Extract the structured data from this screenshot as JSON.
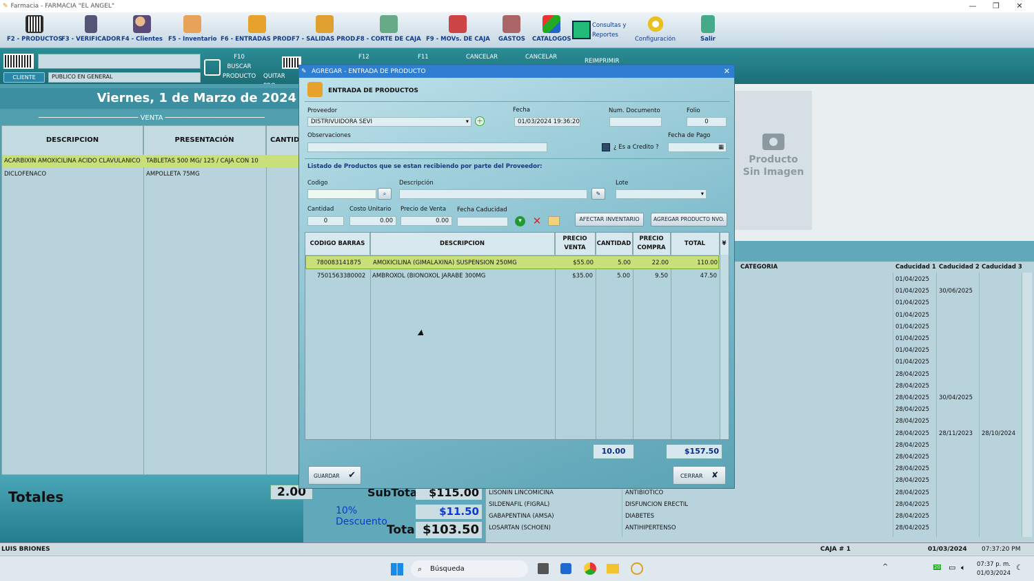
{
  "window": {
    "title": "Farmacia  -  FARMACIA \"EL ANGEL\""
  },
  "toolbar": [
    {
      "key": "f2",
      "label": "F2 - PRODUCTOS"
    },
    {
      "key": "f3",
      "label": "F3 - VERIFICADOR"
    },
    {
      "key": "f4",
      "label": "F4 - Clientes"
    },
    {
      "key": "f5",
      "label": "F5 - Inventario"
    },
    {
      "key": "f6",
      "label": "F6 - ENTRADAS PROD."
    },
    {
      "key": "f7",
      "label": "F7 - SALIDAS PROD."
    },
    {
      "key": "f8",
      "label": "F8 - CORTE DE CAJA"
    },
    {
      "key": "f9",
      "label": "F9 - MOVs. DE CAJA"
    },
    {
      "key": "gastos",
      "label": "GASTOS"
    },
    {
      "key": "catalogos",
      "label": "CATALOGOS"
    },
    {
      "key": "consultas",
      "label": "Consultas y Reportes"
    },
    {
      "key": "config",
      "label": "Configuración"
    },
    {
      "key": "salir",
      "label": "Salir"
    }
  ],
  "strip": {
    "cliente_btn": "CLIENTE",
    "cliente_value": "PUBLICO EN GENERAL",
    "f10_key": "F10",
    "f10_label1": "BUSCAR",
    "f10_label2": "PRODUCTO",
    "quitar": "QUITAR PRO",
    "f12": "F12",
    "f11": "F11",
    "cancelar1": "CANCELAR",
    "cancelar2": "CANCELAR",
    "reimprimir": "REIMPRIMIR"
  },
  "sale": {
    "date": "Viernes, 1 de Marzo de 2024",
    "venta_label": "VENTA",
    "columns": [
      "DESCRIPCION",
      "PRESENTACIÓN",
      "CANTID"
    ],
    "rows": [
      {
        "desc": "ACARBIXIN AMOXICILINA  ACIDO CLAVULANICO",
        "pres": "TABLETAS 500 MG/ 125 / CAJA CON 10"
      },
      {
        "desc": "DICLOFENACO",
        "pres": "AMPOLLETA 75MG"
      }
    ]
  },
  "totals": {
    "label": "Totales",
    "count": "2.00",
    "subtotal_label": "SubTotal",
    "subtotal": "$115.00",
    "discount_label": "10% Descuento",
    "discount": "$11.50",
    "total_label": "Total",
    "total": "$103.50"
  },
  "image_placeholder": {
    "line1": "Producto",
    "line2": "Sin Imagen"
  },
  "right_grid": {
    "columns": {
      "categoria": "CATEGORIA",
      "cad1": "Caducidad 1",
      "cad2": "Caducidad 2",
      "cad3": "Caducidad 3"
    },
    "rows": [
      {
        "name": "",
        "cat": "",
        "c1": "01/04/2025",
        "c2": "",
        "c3": ""
      },
      {
        "name": "",
        "cat": "",
        "c1": "01/04/2025",
        "c2": "30/06/2025",
        "c3": ""
      },
      {
        "name": "",
        "cat": "",
        "c1": "01/04/2025",
        "c2": "",
        "c3": ""
      },
      {
        "name": "",
        "cat": "",
        "c1": "01/04/2025",
        "c2": "",
        "c3": ""
      },
      {
        "name": "",
        "cat": "",
        "c1": "01/04/2025",
        "c2": "",
        "c3": ""
      },
      {
        "name": "",
        "cat": "",
        "c1": "01/04/2025",
        "c2": "",
        "c3": ""
      },
      {
        "name": "",
        "cat": "",
        "c1": "01/04/2025",
        "c2": "",
        "c3": ""
      },
      {
        "name": "",
        "cat": "",
        "c1": "01/04/2025",
        "c2": "",
        "c3": ""
      },
      {
        "name": "",
        "cat": "",
        "c1": "28/04/2025",
        "c2": "",
        "c3": ""
      },
      {
        "name": "",
        "cat": "",
        "c1": "28/04/2025",
        "c2": "",
        "c3": ""
      },
      {
        "name": "",
        "cat": "",
        "c1": "28/04/2025",
        "c2": "30/04/2025",
        "c3": ""
      },
      {
        "name": "",
        "cat": "",
        "c1": "28/04/2025",
        "c2": "",
        "c3": ""
      },
      {
        "name": "",
        "cat": "",
        "c1": "28/04/2025",
        "c2": "",
        "c3": ""
      },
      {
        "name": "",
        "cat": "",
        "c1": "28/04/2025",
        "c2": "28/11/2023",
        "c3": "28/10/2024"
      },
      {
        "name": "",
        "cat": "",
        "c1": "28/04/2025",
        "c2": "",
        "c3": ""
      },
      {
        "name": "",
        "cat": "",
        "c1": "28/04/2025",
        "c2": "",
        "c3": ""
      },
      {
        "name": "",
        "cat": "",
        "c1": "28/04/2025",
        "c2": "",
        "c3": ""
      },
      {
        "name": "",
        "cat": "",
        "c1": "28/04/2025",
        "c2": "",
        "c3": ""
      },
      {
        "name": "LISONIN LINCOMICINA",
        "cat": "ANTIBIOTICO",
        "c1": "28/04/2025",
        "c2": "",
        "c3": ""
      },
      {
        "name": "SILDENAFIL (FIGRAL)",
        "cat": "DISFUNCION ERECTIL",
        "c1": "28/04/2025",
        "c2": "",
        "c3": ""
      },
      {
        "name": "GABAPENTINA (AMSA)",
        "cat": "DIABETES",
        "c1": "28/04/2025",
        "c2": "",
        "c3": ""
      },
      {
        "name": "LOSARTAN (SCHOEN)",
        "cat": "ANTIHIPERTENSO",
        "c1": "28/04/2025",
        "c2": "",
        "c3": ""
      }
    ]
  },
  "status": {
    "user": "LUIS BRIONES",
    "caja": "CAJA # 1",
    "date": "01/03/2024",
    "time": "07:37:20 PM"
  },
  "taskbar": {
    "search": "Búsqueda",
    "time": "07:37 p. m.",
    "date": "01/03/2024",
    "badge": "20"
  },
  "dialog": {
    "title": "AGREGAR - ENTRADA DE PRODUCTO",
    "header": "ENTRADA DE PRODUCTOS",
    "proveedor_label": "Proveedor",
    "proveedor": "DISTRIVUIDORA SEVI",
    "fecha_label": "Fecha",
    "fecha": "01/03/2024 19:36:20",
    "numdoc_label": "Num. Documento",
    "numdoc": "",
    "folio_label": "Folio",
    "folio": "0",
    "obs_label": "Observaciones",
    "obs": "",
    "credito_label": "¿ Es a Credito ?",
    "fechapago_label": "Fecha de Pago",
    "listado": "Listado de Productos que se estan recibiendo por parte del Proveedor:",
    "codigo_label": "Codigo",
    "descripcion_label": "Descripción",
    "lote_label": "Lote",
    "cantidad_label": "Cantidad",
    "cantidad": "0",
    "costo_label": "Costo Unitario",
    "costo": "0.00",
    "precio_label": "Precio de Venta",
    "precio": "0.00",
    "caducidad_label": "Fecha Caducidad",
    "afectar_btn": "AFECTAR INVENTARIO",
    "agregar_btn": "AGREGAR PRODUCTO NVO.",
    "columns": {
      "barras": "CODIGO BARRAS",
      "desc": "DESCRIPCION",
      "pventa": "PRECIO VENTA",
      "cant": "CANTIDAD",
      "pcompra": "PRECIO COMPRA",
      "total": "TOTAL"
    },
    "rows": [
      {
        "barras": "780083141875",
        "desc": "AMOXICILINA (GIMALAXINA)  SUSPENSION 250MG",
        "pventa": "$55.00",
        "cant": "5.00",
        "pcompra": "22.00",
        "total": "110.00"
      },
      {
        "barras": "7501563380002",
        "desc": "AMBROXOL (BIONOXOL  JARABE 300MG",
        "pventa": "$35.00",
        "cant": "5.00",
        "pcompra": "9.50",
        "total": "47.50"
      }
    ],
    "sum_cant": "10.00",
    "sum_total": "$157.50",
    "guardar": "GUARDAR",
    "cerrar": "CERRAR"
  }
}
